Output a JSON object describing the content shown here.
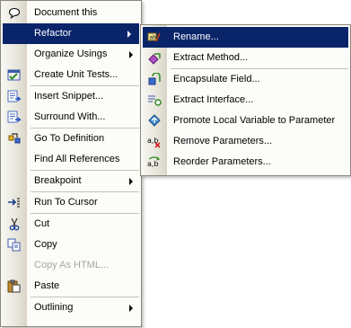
{
  "main_menu": {
    "items": [
      {
        "label": "Document this",
        "icon": "comment-bubble-icon"
      },
      {
        "label": "Refactor",
        "icon": "",
        "submenu": true,
        "selected": true
      },
      {
        "label": "Organize Usings",
        "icon": "",
        "submenu": true
      },
      {
        "label": "Create Unit Tests...",
        "icon": "unit-test-icon"
      },
      {
        "label": "Insert Snippet...",
        "icon": "insert-snippet-icon"
      },
      {
        "label": "Surround With...",
        "icon": "surround-with-icon"
      },
      {
        "label": "Go To Definition",
        "icon": "go-to-definition-icon"
      },
      {
        "label": "Find All References",
        "icon": ""
      },
      {
        "label": "Breakpoint",
        "icon": "",
        "submenu": true
      },
      {
        "label": "Run To Cursor",
        "icon": "run-to-cursor-icon"
      },
      {
        "label": "Cut",
        "icon": "scissors-icon"
      },
      {
        "label": "Copy",
        "icon": "copy-icon"
      },
      {
        "label": "Copy As HTML...",
        "icon": "",
        "disabled": true
      },
      {
        "label": "Paste",
        "icon": "paste-icon"
      },
      {
        "label": "Outlining",
        "icon": "",
        "submenu": true
      }
    ]
  },
  "refactor_menu": {
    "items": [
      {
        "label": "Rename...",
        "icon": "rename-icon",
        "selected": true
      },
      {
        "label": "Extract Method...",
        "icon": "extract-method-icon"
      },
      {
        "label": "Encapsulate Field...",
        "icon": "encapsulate-field-icon"
      },
      {
        "label": "Extract Interface...",
        "icon": "extract-interface-icon"
      },
      {
        "label": "Promote Local Variable to Parameter",
        "icon": "promote-variable-icon"
      },
      {
        "label": "Remove Parameters...",
        "icon": "remove-parameters-icon"
      },
      {
        "label": "Reorder Parameters...",
        "icon": "reorder-parameters-icon"
      }
    ]
  },
  "colors": {
    "selection": "#0a246a",
    "menu_background": "#fcfcf9",
    "gutter": "#e8e6dc",
    "disabled_text": "#a8a59b"
  }
}
